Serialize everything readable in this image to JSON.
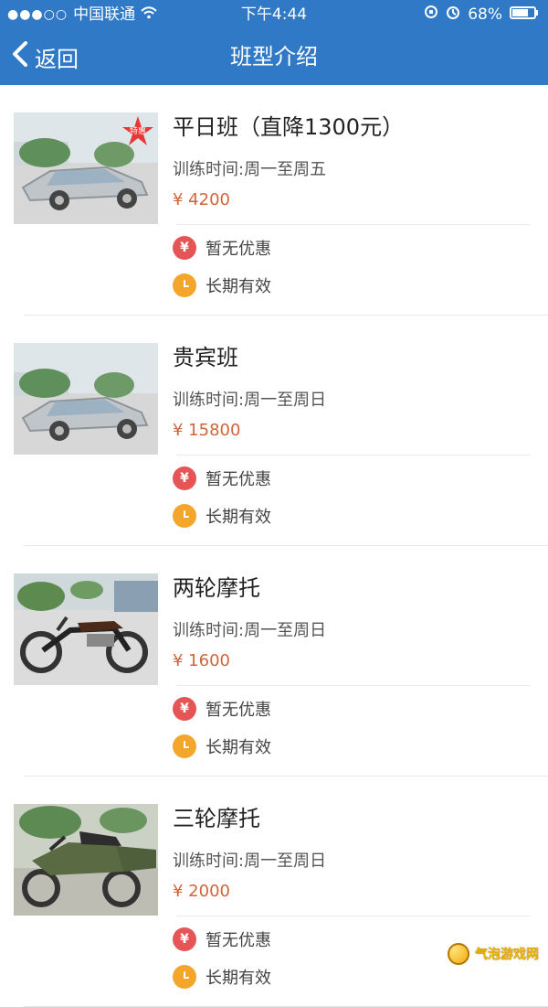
{
  "status_bar": {
    "signal": "●●●○○",
    "carrier": "中国联通",
    "time": "下午4:44",
    "battery": "68%"
  },
  "nav": {
    "back_label": "返回",
    "title": "班型介绍"
  },
  "courses": [
    {
      "title": "平日班（直降1300元）",
      "training_time": "训练时间:周一至周五",
      "price": "¥ 4200",
      "promo": "暂无优惠",
      "validity": "长期有效",
      "badge": "特惠",
      "image": "car"
    },
    {
      "title": "贵宾班",
      "training_time": "训练时间:周一至周日",
      "price": "¥ 15800",
      "promo": "暂无优惠",
      "validity": "长期有效",
      "image": "car"
    },
    {
      "title": "两轮摩托",
      "training_time": "训练时间:周一至周日",
      "price": "¥ 1600",
      "promo": "暂无优惠",
      "validity": "长期有效",
      "image": "motorcycle"
    },
    {
      "title": "三轮摩托",
      "training_time": "训练时间:周一至周日",
      "price": "¥ 2000",
      "promo": "暂无优惠",
      "validity": "长期有效",
      "image": "sidecar"
    }
  ],
  "icons": {
    "promo_glyph": "¥"
  },
  "watermark": "气泡游戏网",
  "colors": {
    "header": "#2f79c6",
    "price": "#d0643b",
    "promo_icon": "#e65555",
    "clock_icon": "#f4a62b"
  }
}
